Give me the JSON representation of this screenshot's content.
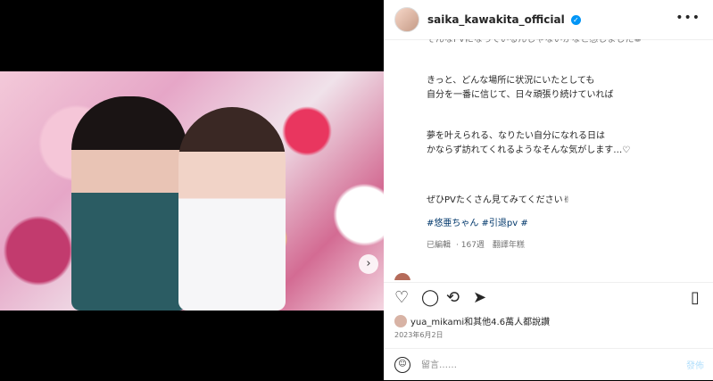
{
  "header": {
    "username": "saika_kawakita_official",
    "verified_icon": "✓",
    "more_icon": "•••"
  },
  "caption": {
    "line_cut": "そんなPVになっているんじゃないかなと感じました❁",
    "line_1": "きっと、どんな場所に状況にいたとしても",
    "line_2": "自分を一番に信じて、日々頑張り続けていれば",
    "line_3": "夢を叶えられる、なりたい自分になれる日は",
    "line_4": "かならず訪れてくれるようなそんな気がします…♡",
    "line_5": "ぜひPVたくさん見てみてください✌",
    "tags": "#悠亜ちゃん #引退pv #",
    "edited": "已編輯",
    "time": "167週",
    "translate": "翻譯年糕"
  },
  "likes": {
    "text": "yua_mikami和其他4.6萬人都說讚"
  },
  "date": "2023年6月2日",
  "comment_bar": {
    "placeholder": "留言……",
    "post": "發佈"
  },
  "icons": {
    "like": "heart-icon",
    "comment": "comment-icon",
    "share": "repost-icon",
    "send": "send-icon",
    "save": "bookmark-icon"
  },
  "photo_controls": {
    "next": "›",
    "tag": "👤"
  }
}
